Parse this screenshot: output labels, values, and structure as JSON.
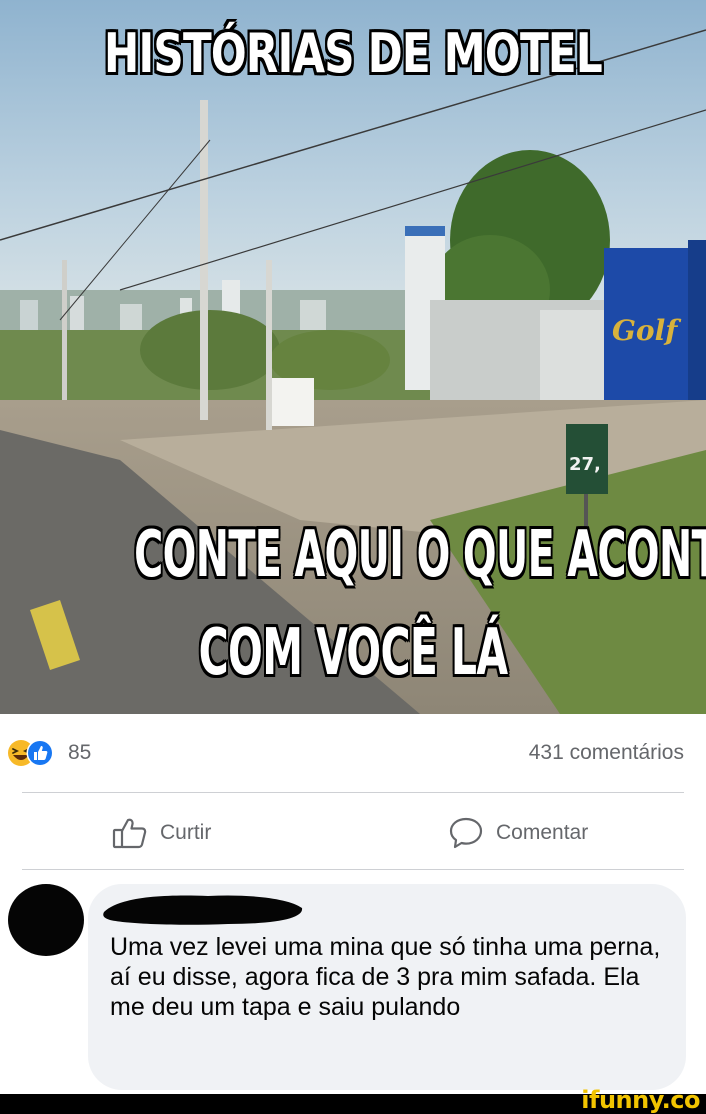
{
  "post": {
    "image": {
      "caption_top": "HISTÓRIAS DE MOTEL",
      "caption_middle": "CONTE AQUI O QUE ACONTECEU",
      "caption_bottom": "COM VOCÊ LÁ",
      "sign_text": "Golf",
      "price_sign_text": "27,"
    },
    "reactions": {
      "icons": [
        "haha-reaction-icon",
        "like-reaction-icon"
      ],
      "count": "85"
    },
    "comments_count": "431 comentários",
    "actions": {
      "like_label": "Curtir",
      "comment_label": "Comentar"
    }
  },
  "comment": {
    "author_redacted": true,
    "text": "Uma vez levei uma mina que só tinha uma perna, aí eu disse, agora fica de 3 pra mim safada. Ela me deu um tapa e saiu pulando"
  },
  "watermark": "ifunny.co",
  "colors": {
    "secondary_text": "#65676b",
    "divider": "#ced0d4",
    "bubble": "#f0f2f5",
    "like_blue": "#1877f2",
    "haha_yellow": "#f7b928",
    "watermark_yellow": "#f2c400"
  }
}
